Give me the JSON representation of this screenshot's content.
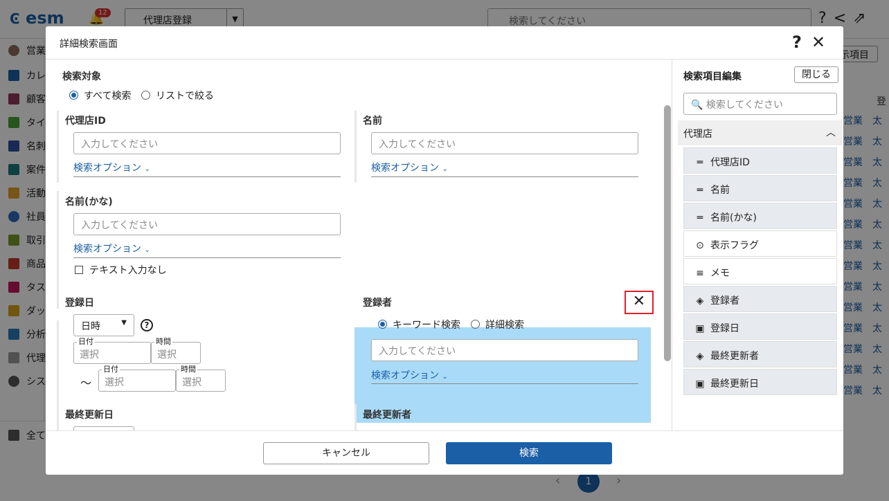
{
  "app": {
    "logo": "esm",
    "notification_count": "12",
    "tab_label": "代理店登録",
    "search_placeholder": "検索してください",
    "display_items_button": "示項目",
    "sidebar": [
      "営業",
      "カレ",
      "顧客",
      "タイ",
      "名刺",
      "案件",
      "活動",
      "社員",
      "取引",
      "商品",
      "タス",
      "ダッ",
      "分析",
      "代理",
      "シス"
    ],
    "sidebar_all": "全て",
    "right_header": "登",
    "right_rows": [
      "営業",
      "営業",
      "営業",
      "営業",
      "営業",
      "営業",
      "営業",
      "営業",
      "営業",
      "営業",
      "営業",
      "営業",
      "営業",
      "営業"
    ],
    "right_rows2": [
      "太",
      "太",
      "太",
      "太",
      "太",
      "太",
      "太",
      "太",
      "太",
      "太",
      "太",
      "太",
      "太",
      "太"
    ],
    "page_number": "1"
  },
  "modal": {
    "title": "詳細検索画面",
    "search_target": {
      "label": "検索対象",
      "options": [
        "すべて検索",
        "リストで絞る"
      ],
      "selected": "すべて検索"
    },
    "fields": {
      "agency_id": {
        "label": "代理店ID",
        "placeholder": "入力してください",
        "option": "検索オプション"
      },
      "name": {
        "label": "名前",
        "placeholder": "入力してください",
        "option": "検索オプション"
      },
      "name_kana": {
        "label": "名前(かな)",
        "placeholder": "入力してください",
        "option": "検索オプション",
        "no_text": "テキスト入力なし"
      },
      "registered_date": {
        "label": "登録日",
        "select_value": "日時",
        "date_caption": "日付",
        "time_caption": "時間",
        "date_value": "選択",
        "time_value": "選択",
        "range_sep": "〜"
      },
      "registered_by": {
        "label": "登録者",
        "options": [
          "キーワード検索",
          "詳細検索"
        ],
        "selected": "キーワード検索",
        "placeholder": "入力してください",
        "option": "検索オプション"
      },
      "last_updated_date": {
        "label": "最終更新日"
      },
      "last_updated_by": {
        "label": "最終更新者"
      }
    },
    "footer": {
      "cancel": "キャンセル",
      "search": "検索"
    }
  },
  "editor": {
    "title": "検索項目編集",
    "close": "閉じる",
    "search_placeholder": "検索してください",
    "group": "代理店",
    "items": [
      {
        "label": "代理店ID",
        "icon": "text-lines-icon",
        "state": "added"
      },
      {
        "label": "名前",
        "icon": "text-lines-icon",
        "state": "added"
      },
      {
        "label": "名前(かな)",
        "icon": "text-lines-icon",
        "state": "added"
      },
      {
        "label": "表示フラグ",
        "icon": "dropdown-circle-icon",
        "state": "available"
      },
      {
        "label": "メモ",
        "icon": "paragraph-icon",
        "state": "available"
      },
      {
        "label": "登録者",
        "icon": "user-tag-icon",
        "state": "added"
      },
      {
        "label": "登録日",
        "icon": "calendar-icon",
        "state": "added"
      },
      {
        "label": "最終更新者",
        "icon": "user-tag-icon",
        "state": "added"
      },
      {
        "label": "最終更新日",
        "icon": "calendar-icon",
        "state": "added"
      }
    ]
  },
  "colors": {
    "accent": "#1b5fa6",
    "highlight": "#a9dbf9",
    "marker": "#e0202a"
  }
}
